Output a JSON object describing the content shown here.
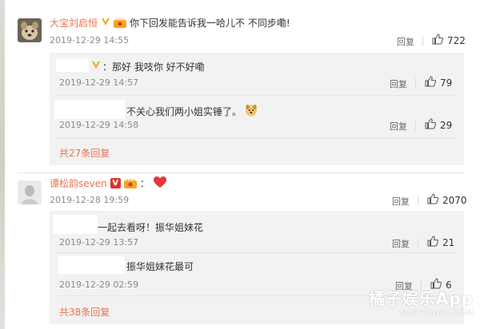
{
  "comments": [
    {
      "user": "大宝刘启恒",
      "text": "你下回发能告诉我一哈儿不 不同步嘞!",
      "time": "2019-12-29 14:55",
      "reply_label": "回复",
      "likes": "722",
      "replies": [
        {
          "text": "那好 我吱你 好不好嘞",
          "time": "2019-12-29 14:57",
          "reply_label": "回复",
          "likes": "79"
        },
        {
          "text": "不关心我们两小姐实锤了。",
          "time": "2019-12-29 14:58",
          "reply_label": "回复",
          "likes": "29"
        }
      ],
      "more_replies": "共27条回复"
    },
    {
      "user": "谭松韵seven",
      "time": "2019-12-28 19:59",
      "reply_label": "回复",
      "likes": "2070",
      "replies": [
        {
          "text": "一起去看呀！振华姐妹花",
          "time": "2019-12-29 13:57",
          "reply_label": "回复",
          "likes": "21"
        },
        {
          "text": "振华姐妹花最可",
          "time": "2019-12-29 02:59",
          "reply_label": "回复",
          "likes": "6"
        }
      ],
      "more_replies": "共38条回复"
    }
  ],
  "watermark": {
    "title": "橘子娱乐App",
    "sub": "HAPPYJUZI.COM"
  },
  "icons": [
    "thumbs-up-icon",
    "verified-v-icon",
    "crown-badge-icon",
    "dog-emoji-icon",
    "heart-emoji-icon"
  ]
}
